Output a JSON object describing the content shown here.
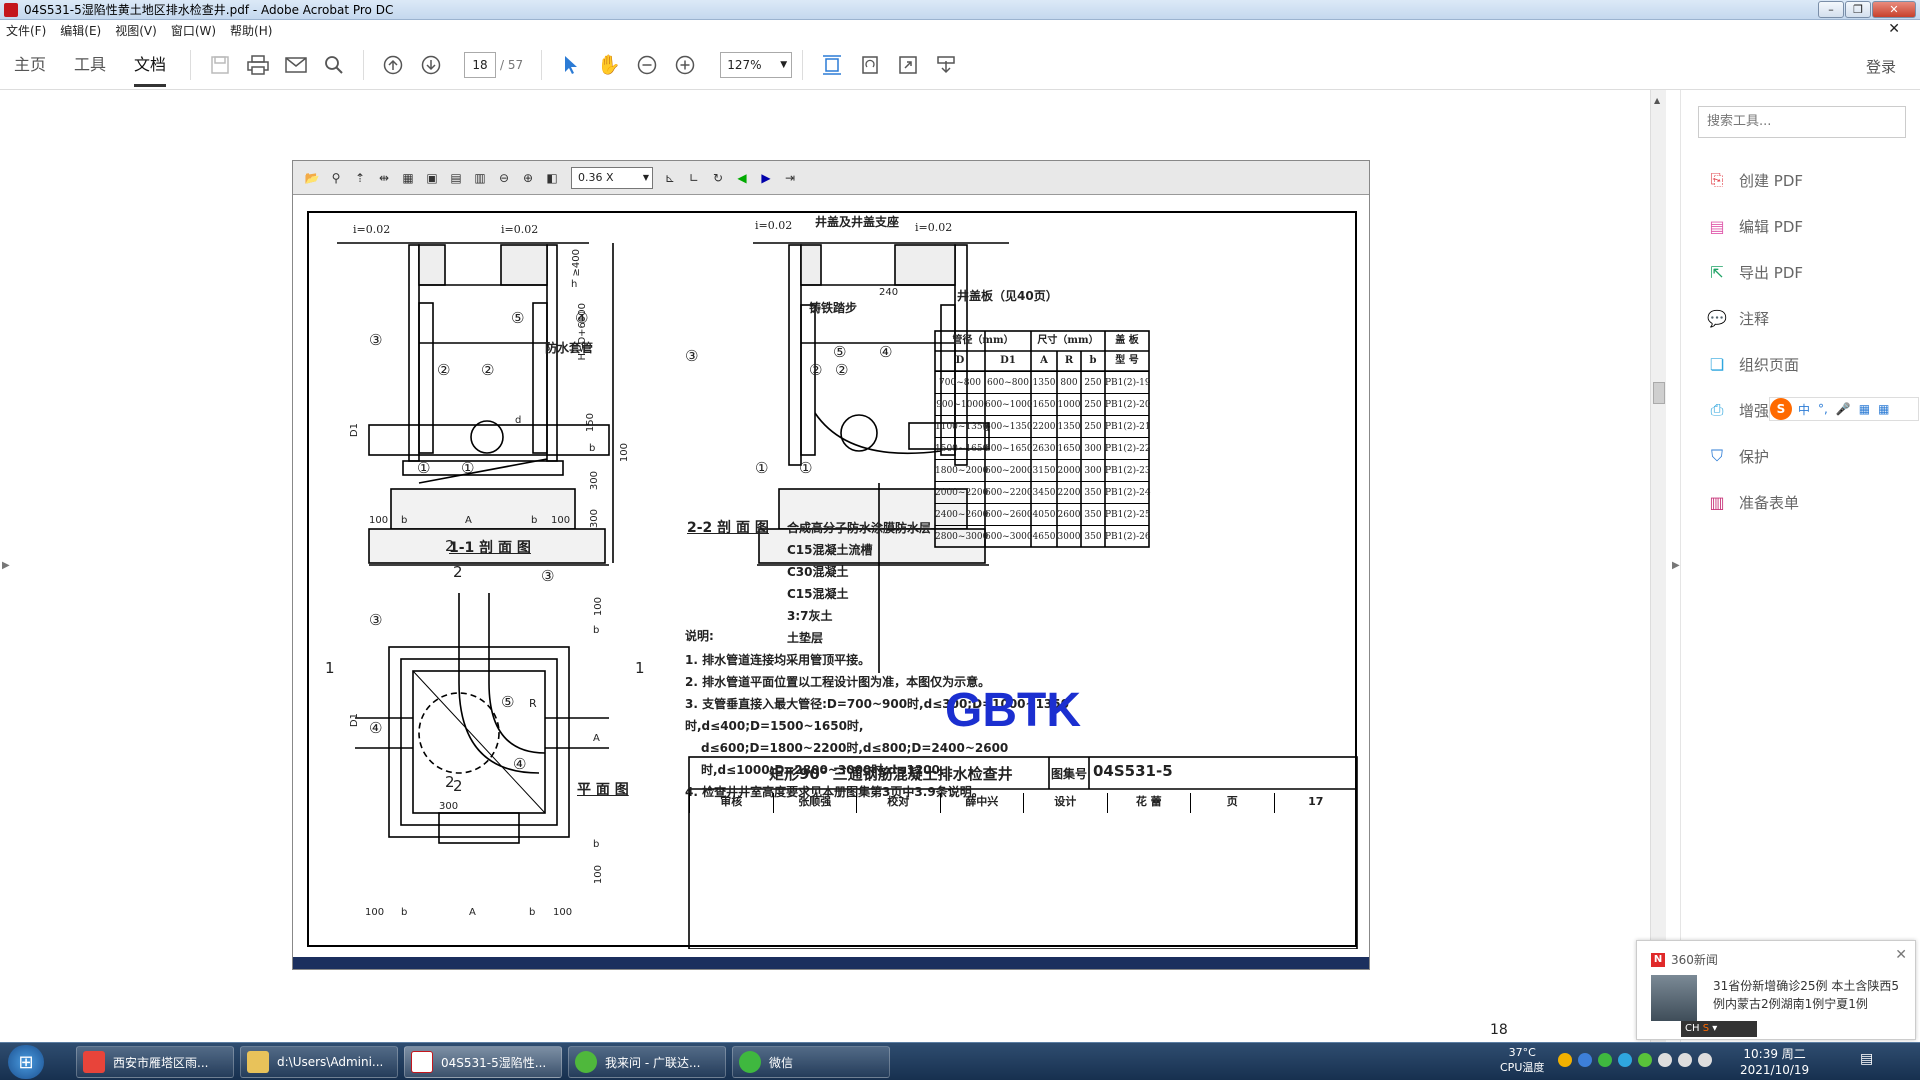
{
  "window": {
    "title": "04S531-5湿陷性黄土地区排水检查井.pdf - Adobe Acrobat Pro DC"
  },
  "menu": [
    "文件(F)",
    "编辑(E)",
    "视图(V)",
    "窗口(W)",
    "帮助(H)"
  ],
  "tabs": [
    "主页",
    "工具",
    "文档"
  ],
  "toolbar": {
    "page_current": "18",
    "page_total": "/ 57",
    "zoom": "127%",
    "login": "登录"
  },
  "right_panel": {
    "search_placeholder": "搜索工具...",
    "tools": [
      "创建 PDF",
      "编辑 PDF",
      "导出 PDF",
      "注释",
      "组织页面",
      "增强扫描",
      "保护",
      "准备表单"
    ],
    "ime": [
      "中",
      "°,",
      "🎤",
      "▦",
      "▦"
    ]
  },
  "viewer": {
    "zoom": "0.36 X"
  },
  "drawing": {
    "labels_top": [
      "i=0.02",
      "i=0.02",
      "i=0.02",
      "i=0.02",
      "井盖及井盖支座"
    ],
    "labels_misc": [
      "防水套管",
      "铸铁踏步",
      "井盖板（见40页）",
      "240",
      "H≤D+6000",
      "≥400",
      "h",
      "150",
      "b",
      "100",
      "300",
      "300",
      "D1",
      "d",
      "D1",
      "d",
      "R",
      "300",
      "100",
      "b",
      "A",
      "b",
      "100",
      "100",
      "b",
      "A",
      "b",
      "100",
      "100",
      "b",
      "A",
      "b",
      "100"
    ],
    "callouts": [
      "①",
      "①",
      "②",
      "②",
      "③",
      "④",
      "⑤",
      "①",
      "①",
      "②",
      "②",
      "③",
      "④",
      "⑤",
      "③",
      "③",
      "④",
      "④",
      "⑤",
      "1",
      "1",
      "2",
      "2",
      "2",
      "2"
    ],
    "section_titles": [
      "1-1 剖 面 图",
      "2-2 剖 面 图",
      "平 面 图"
    ],
    "layers": [
      "合成高分子防水涂膜防水层",
      "C15混凝土流槽",
      "C30混凝土",
      "C15混凝土",
      "3:7灰土",
      "土垫层"
    ],
    "table": {
      "head1": [
        "管径（mm）",
        "尺寸（mm）",
        "盖 板"
      ],
      "head2": [
        "D",
        "D1",
        "A",
        "R",
        "b",
        "型 号"
      ],
      "rows": [
        [
          "700~800",
          "600~800",
          "1350",
          "800",
          "250",
          "PB1(2)-19"
        ],
        [
          "900~1000",
          "600~1000",
          "1650",
          "1000",
          "250",
          "PB1(2)-20"
        ],
        [
          "1100~1350",
          "600~1350",
          "2200",
          "1350",
          "250",
          "PB1(2)-21"
        ],
        [
          "1500~1650",
          "600~1650",
          "2630",
          "1650",
          "300",
          "PB1(2)-22"
        ],
        [
          "1800~2000",
          "600~2000",
          "3150",
          "2000",
          "300",
          "PB1(2)-23"
        ],
        [
          "2000~2200",
          "600~2200",
          "3450",
          "2200",
          "350",
          "PB1(2)-24"
        ],
        [
          "2400~2600",
          "600~2600",
          "4050",
          "2600",
          "350",
          "PB1(2)-25"
        ],
        [
          "2800~3000",
          "600~3000",
          "4650",
          "3000",
          "350",
          "PB1(2)-26"
        ]
      ]
    },
    "notes_title": "说明:",
    "notes": [
      "1. 排水管道连接均采用管顶平接。",
      "2. 排水管道平面位置以工程设计图为准，本图仅为示意。",
      "3. 支管垂直接入最大管径:D=700~900时,d≤300;D=1000~1350时,d≤400;D=1500~1650时,",
      "d≤600;D=1800~2200时,d≤800;D=2400~2600时,d≤1000;D=2800~3000时,d≤1200.",
      "4. 检查井井室高度要求见本册图集第3页中3.9条说明。"
    ],
    "watermark": "GBTK",
    "titleblock": {
      "name": "矩形90° 三通钢筋混凝土排水检查井",
      "atlas_label": "图集号",
      "atlas": "04S531-5",
      "row": [
        "审核",
        "张顺强",
        "校对",
        "薛中兴",
        "设计",
        "花 蕾",
        "页",
        "17"
      ]
    }
  },
  "page_number": "18",
  "news": {
    "brand": "360新闻",
    "text": "31省份新增确诊25例 本土含陕西5例内蒙古2例湖南1例宁夏1例",
    "ime": "CH"
  },
  "taskbar": {
    "items": [
      "西安市雁塔区雨...",
      "d:\\Users\\Admini...",
      "04S531-5湿陷性...",
      "我来问 - 广联达...",
      "微信"
    ],
    "temp": "37°C",
    "cpu": "CPU温度",
    "time": "10:39 周二",
    "date": "2021/10/19"
  }
}
